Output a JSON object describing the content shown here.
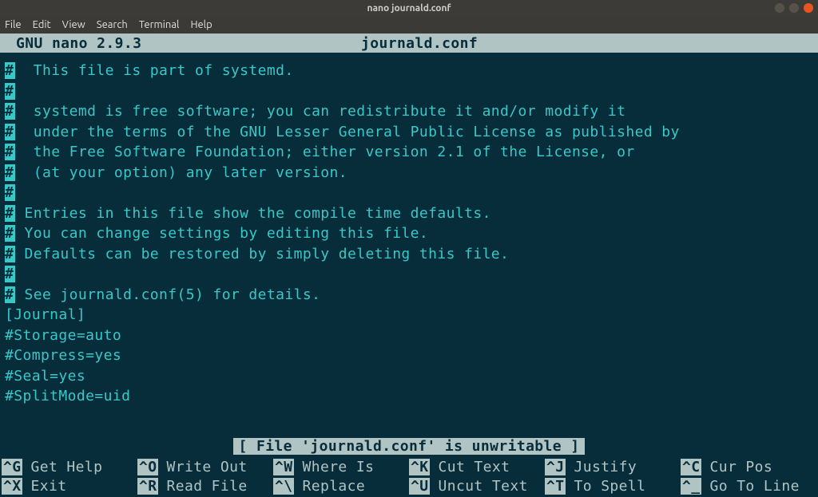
{
  "window": {
    "title": "nano journald.conf"
  },
  "menu": {
    "items": [
      "File",
      "Edit",
      "View",
      "Search",
      "Terminal",
      "Help"
    ]
  },
  "nano": {
    "version": "GNU nano 2.9.3",
    "filename": "journald.conf",
    "status": "[ File 'journald.conf' is unwritable ]"
  },
  "content": {
    "lines": [
      {
        "hash": "#",
        "text": "  This file is part of systemd."
      },
      {
        "hash": "#",
        "text": ""
      },
      {
        "hash": "#",
        "text": "  systemd is free software; you can redistribute it and/or modify it"
      },
      {
        "hash": "#",
        "text": "  under the terms of the GNU Lesser General Public License as published by"
      },
      {
        "hash": "#",
        "text": "  the Free Software Foundation; either version 2.1 of the License, or"
      },
      {
        "hash": "#",
        "text": "  (at your option) any later version."
      },
      {
        "hash": "#",
        "text": ""
      },
      {
        "hash": "#",
        "text": " Entries in this file show the compile time defaults."
      },
      {
        "hash": "#",
        "text": " You can change settings by editing this file."
      },
      {
        "hash": "#",
        "text": " Defaults can be restored by simply deleting this file."
      },
      {
        "hash": "#",
        "text": ""
      },
      {
        "hash": "#",
        "text": " See journald.conf(5) for details."
      },
      {
        "hash": "",
        "text": ""
      },
      {
        "hash": "",
        "text": "[Journal]"
      },
      {
        "hash": "",
        "text": "#Storage=auto"
      },
      {
        "hash": "",
        "text": "#Compress=yes"
      },
      {
        "hash": "",
        "text": "#Seal=yes"
      },
      {
        "hash": "",
        "text": "#SplitMode=uid"
      }
    ]
  },
  "shortcuts": [
    {
      "key": "^G",
      "label": "Get Help"
    },
    {
      "key": "^O",
      "label": "Write Out"
    },
    {
      "key": "^W",
      "label": "Where Is"
    },
    {
      "key": "^K",
      "label": "Cut Text"
    },
    {
      "key": "^J",
      "label": "Justify"
    },
    {
      "key": "^C",
      "label": "Cur Pos"
    },
    {
      "key": "^X",
      "label": "Exit"
    },
    {
      "key": "^R",
      "label": "Read File"
    },
    {
      "key": "^\\",
      "label": "Replace"
    },
    {
      "key": "^U",
      "label": "Uncut Text"
    },
    {
      "key": "^T",
      "label": "To Spell"
    },
    {
      "key": "^_",
      "label": "Go To Line"
    }
  ]
}
